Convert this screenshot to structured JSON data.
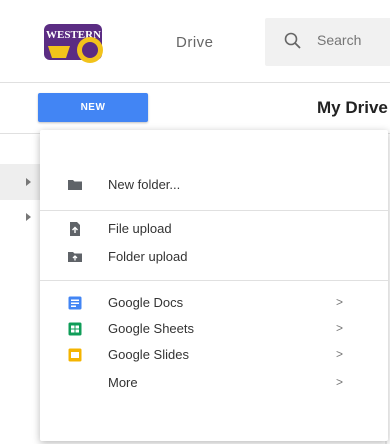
{
  "header": {
    "logo_text": "WESTERN",
    "product_name": "Drive",
    "search_placeholder": "Search"
  },
  "toolbar": {
    "new_label": "NEW",
    "drive_title": "My Drive"
  },
  "new_menu": {
    "new_folder": "New folder...",
    "file_upload": "File upload",
    "folder_upload": "Folder upload",
    "google_docs": "Google Docs",
    "google_sheets": "Google Sheets",
    "google_slides": "Google Slides",
    "more": "More",
    "chevron": ">"
  },
  "colors": {
    "new_button": "#4285f4",
    "docs": "#4285f4",
    "sheets": "#0f9d58",
    "slides": "#f4b400",
    "logo_purple": "#5b2c83",
    "logo_gold": "#f2c31b"
  }
}
